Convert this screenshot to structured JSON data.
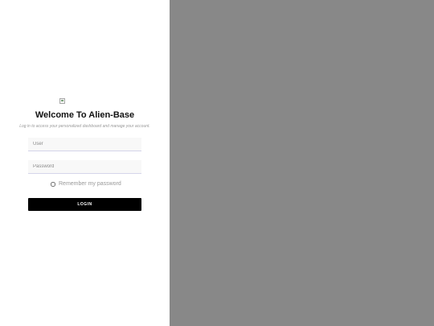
{
  "login": {
    "title": "Welcome To Alien-Base",
    "subtitle": "Log in to access your personalized dashboard and manage your account.",
    "user_placeholder": "User",
    "password_placeholder": "Password",
    "remember_label": "Remember my password",
    "login_button": "LOGIN"
  },
  "colors": {
    "left_panel": "#ffffff",
    "right_panel": "#888888",
    "button": "#000000",
    "input_bg": "#f8f8f8",
    "input_underline": "#d5d5ea"
  },
  "icons": {
    "logo": "broken-image-icon"
  }
}
